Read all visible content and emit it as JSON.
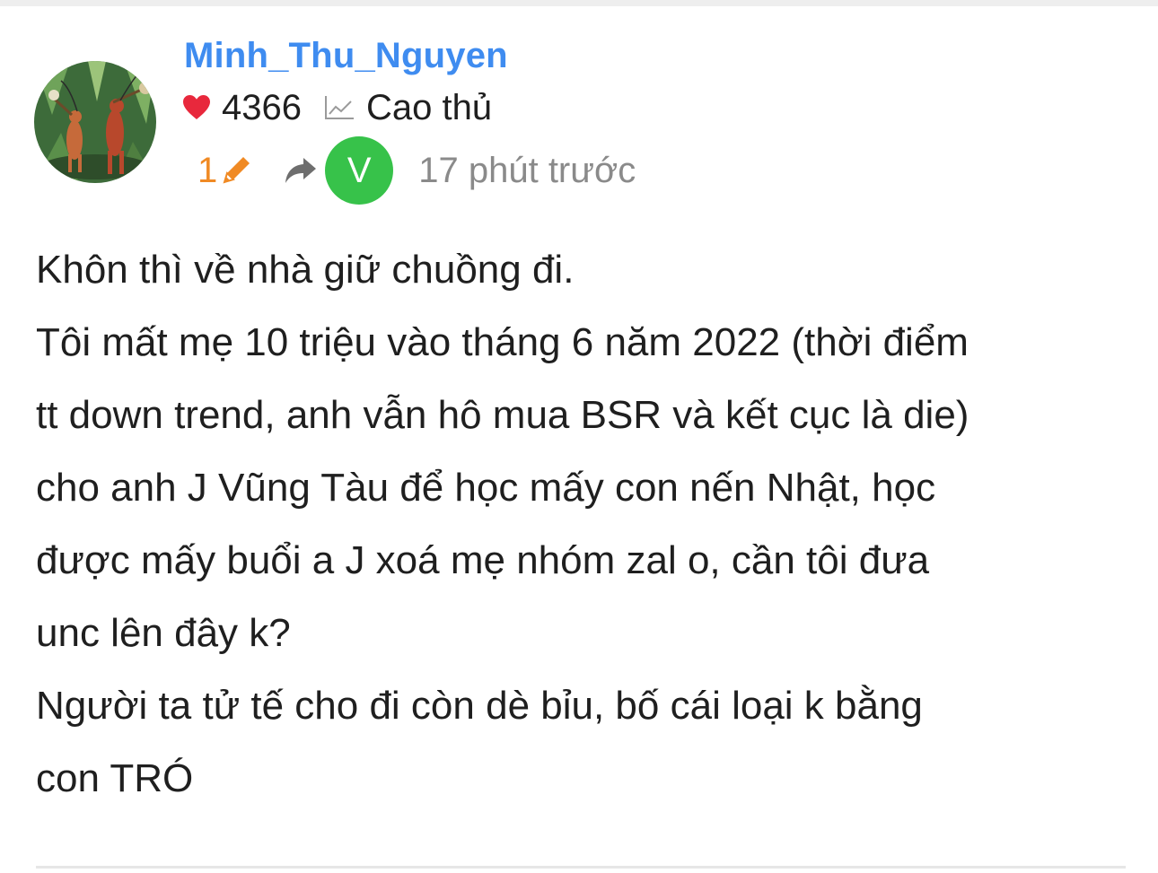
{
  "post": {
    "author": {
      "username": "Minh_Thu_Nguyen",
      "likes": "4366",
      "rank": "Cao thủ",
      "avatar": "illustrated-grasshopper-travelers-avatar"
    },
    "meta": {
      "edit_count": "1",
      "verified_initial": "V",
      "time_ago": "17 phút trước"
    },
    "body_lines": [
      "Khôn thì về nhà giữ chuồng đi.",
      "Tôi mất mẹ 10 triệu vào tháng 6 năm 2022 (thời điểm",
      "tt down trend, anh vẫn hô mua BSR và kết cục là die)",
      "cho anh J Vũng Tàu để học mấy con nến Nhật, học",
      "được mấy buổi a J xoá mẹ nhóm zal o, cần tôi đưa",
      "unc lên đây k?",
      "Người ta tử tế cho đi còn dè bỉu, bố cái loại k bằng",
      "con TRÓ"
    ]
  },
  "icons": {
    "heart": "heart-icon",
    "rank": "trending-chart-icon",
    "edit": "pencil-icon",
    "share": "share-arrow-icon"
  },
  "colors": {
    "username": "#3f8cf0",
    "heart": "#e8283c",
    "edit_count": "#f08a24",
    "verified_badge": "#37c24a",
    "timestamp": "#8a8a8a",
    "text": "#1f1f1f"
  }
}
